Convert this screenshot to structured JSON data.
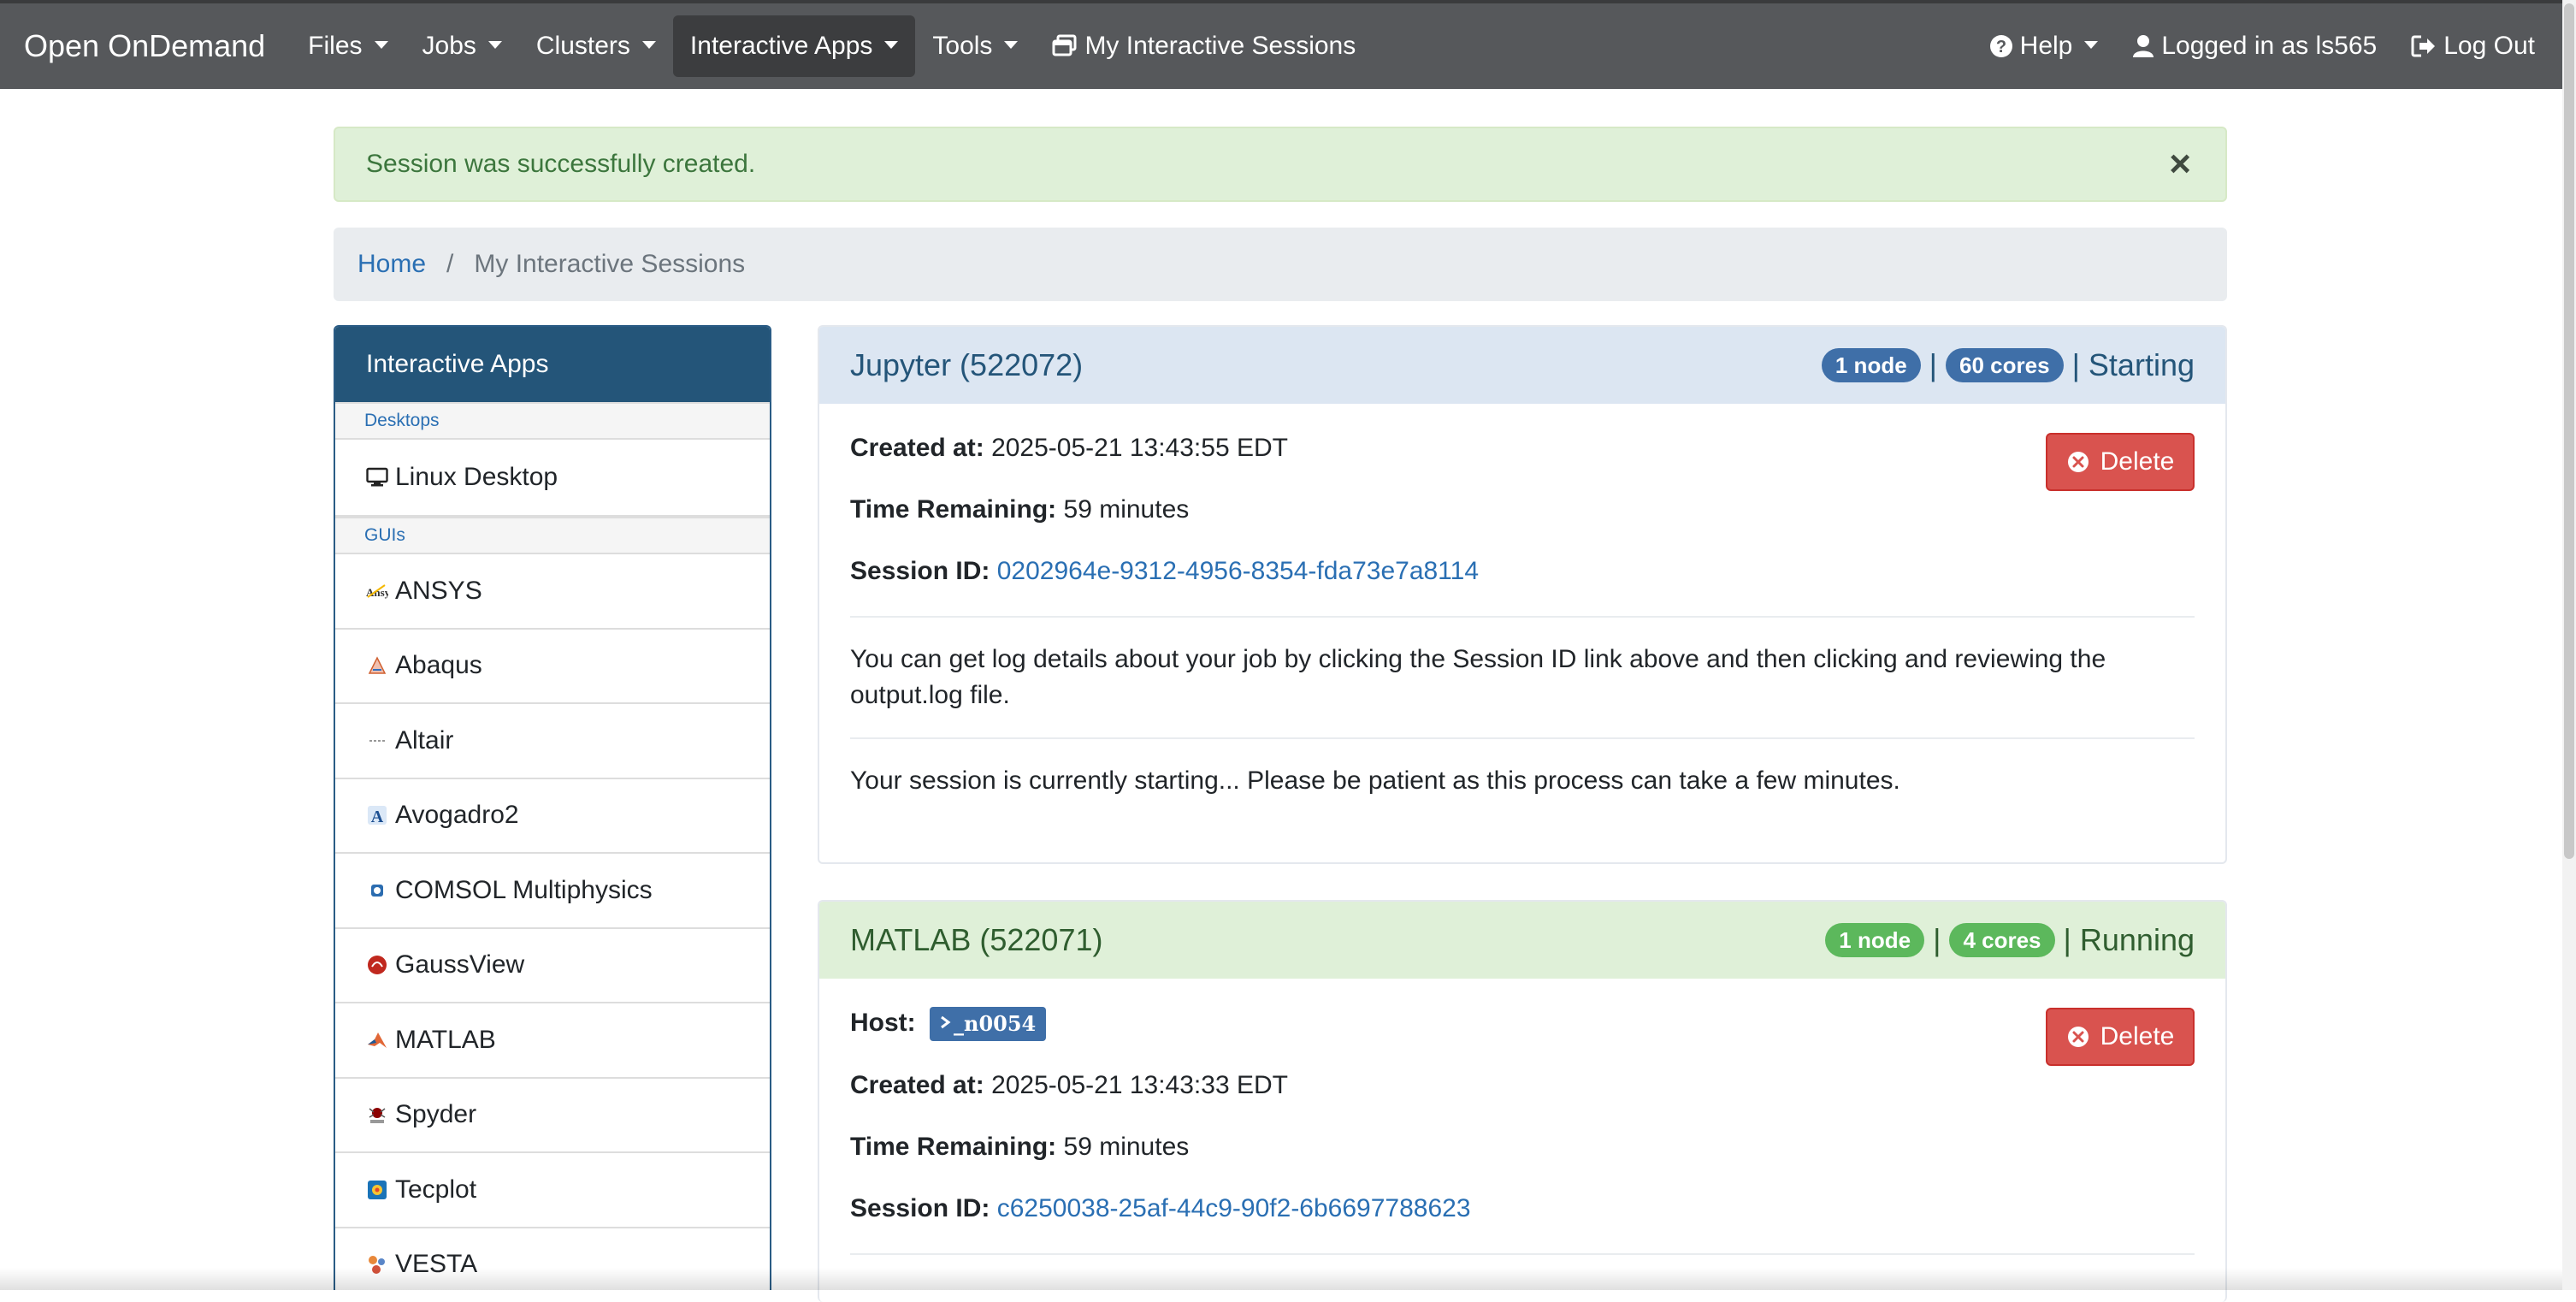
{
  "navbar": {
    "brand": "Open OnDemand",
    "items": [
      {
        "label": "Files"
      },
      {
        "label": "Jobs"
      },
      {
        "label": "Clusters"
      },
      {
        "label": "Interactive Apps"
      },
      {
        "label": "Tools"
      },
      {
        "label": "My Interactive Sessions"
      }
    ],
    "help": "Help",
    "logged_in": "Logged in as ls565",
    "logout": "Log Out"
  },
  "alert": {
    "message": "Session was successfully created.",
    "close": "×"
  },
  "breadcrumb": {
    "home": "Home",
    "separator": "/",
    "current": "My Interactive Sessions"
  },
  "sidebar": {
    "title": "Interactive Apps",
    "categories": [
      {
        "label": "Desktops",
        "items": [
          {
            "label": "Linux Desktop",
            "icon": "monitor-icon"
          }
        ]
      },
      {
        "label": "GUIs",
        "items": [
          {
            "label": "ANSYS",
            "icon": "ansys-icon"
          },
          {
            "label": "Abaqus",
            "icon": "abaqus-icon"
          },
          {
            "label": "Altair",
            "icon": "altair-icon"
          },
          {
            "label": "Avogadro2",
            "icon": "avogadro-icon"
          },
          {
            "label": "COMSOL Multiphysics",
            "icon": "comsol-icon"
          },
          {
            "label": "GaussView",
            "icon": "gaussview-icon"
          },
          {
            "label": "MATLAB",
            "icon": "matlab-icon"
          },
          {
            "label": "Spyder",
            "icon": "spyder-icon"
          },
          {
            "label": "Tecplot",
            "icon": "tecplot-icon"
          },
          {
            "label": "VESTA",
            "icon": "vesta-icon"
          }
        ]
      }
    ]
  },
  "sessions": [
    {
      "title": "Jupyter (522072)",
      "nodes": "1 node",
      "cores": "60 cores",
      "status": "Starting",
      "pipe": "|",
      "created_label": "Created at:",
      "created": "2025-05-21 13:43:55 EDT",
      "remaining_label": "Time Remaining:",
      "remaining": "59 minutes",
      "session_id_label": "Session ID:",
      "session_id": "0202964e-9312-4956-8354-fda73e7a8114",
      "log_note": "You can get log details about your job by clicking the Session ID link above and then clicking and reviewing the output.log file.",
      "status_note": "Your session is currently starting... Please be patient as this process can take a few minutes.",
      "delete": "Delete"
    },
    {
      "title": "MATLAB (522071)",
      "nodes": "1 node",
      "cores": "4 cores",
      "status": "Running",
      "pipe": "|",
      "host_label": "Host:",
      "host": "_n0054",
      "created_label": "Created at:",
      "created": "2025-05-21 13:43:33 EDT",
      "remaining_label": "Time Remaining:",
      "remaining": "59 minutes",
      "session_id_label": "Session ID:",
      "session_id": "c6250038-25af-44c9-90f2-6b6697788623",
      "delete": "Delete"
    }
  ],
  "colors": {
    "navbar": "#56585b",
    "sidebar_header": "#245579",
    "link": "#2a6fb3",
    "delete": "#d9534f",
    "starting_header": "#dce6f2",
    "running_header": "#dff0d8"
  }
}
